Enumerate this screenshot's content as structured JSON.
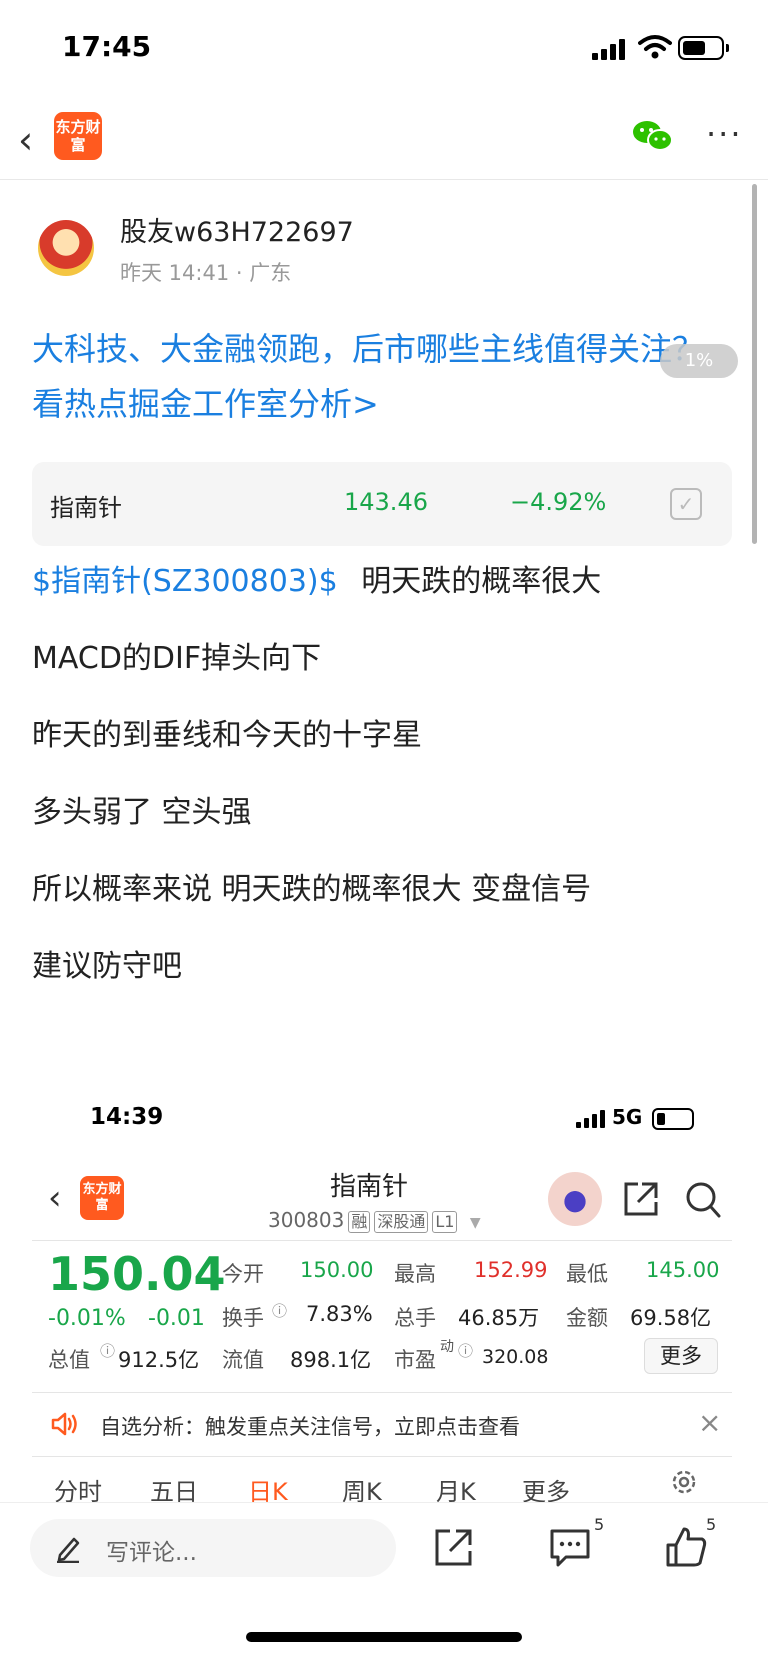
{
  "status": {
    "time": "17:45"
  },
  "nav": {
    "logo": "东方财富"
  },
  "post": {
    "author": "股友w63H722697",
    "meta": "昨天 14:41 · 广东",
    "headline": "大科技、大金融领跑，后市哪些主线值得关注？看热点掘金工作室分析>",
    "progress_badge": "1%",
    "stock_card": {
      "name": "指南针",
      "price": "143.46",
      "change": "−4.92%"
    },
    "stock_link": "$指南针(SZ300803)$",
    "paragraphs": [
      "明天跌的概率很大",
      "MACD的DIF掉头向下",
      "昨天的到垂线和今天的十字星",
      "多头弱了 空头强",
      "所以概率来说 明天跌的概率很大 变盘信号",
      "建议防守吧"
    ]
  },
  "embedded": {
    "time": "14:39",
    "network": "5G",
    "title": "指南针",
    "code": "300803",
    "tags": [
      "融",
      "深股通",
      "L1"
    ],
    "price": "150.04",
    "change_pct": "-0.01%",
    "change_abs": "-0.01",
    "stats": {
      "open_label": "今开",
      "open": "150.00",
      "high_label": "最高",
      "high": "152.99",
      "low_label": "最低",
      "low": "145.00",
      "turnover_label": "换手",
      "turnover": "7.83%",
      "volume_label": "总手",
      "volume": "46.85万",
      "amount_label": "金额",
      "amount": "69.58亿",
      "mktcap_label": "总值",
      "mktcap": "912.5亿",
      "float_label": "流值",
      "float": "898.1亿",
      "pe_label": "市盈",
      "pe_sup": "动",
      "pe": "320.08"
    },
    "more_label": "更多",
    "alert": "自选分析：触发重点关注信号，立即点击查看",
    "tabs": [
      "分时",
      "五日",
      "日K",
      "周K",
      "月K",
      "更多"
    ]
  },
  "bottom": {
    "comment_placeholder": "写评论...",
    "comment_count": "5",
    "like_count": "5"
  },
  "colors": {
    "up": "#e0302b",
    "down": "#19a64a",
    "link": "#1a7fe0",
    "brand": "#ff5a1f"
  }
}
